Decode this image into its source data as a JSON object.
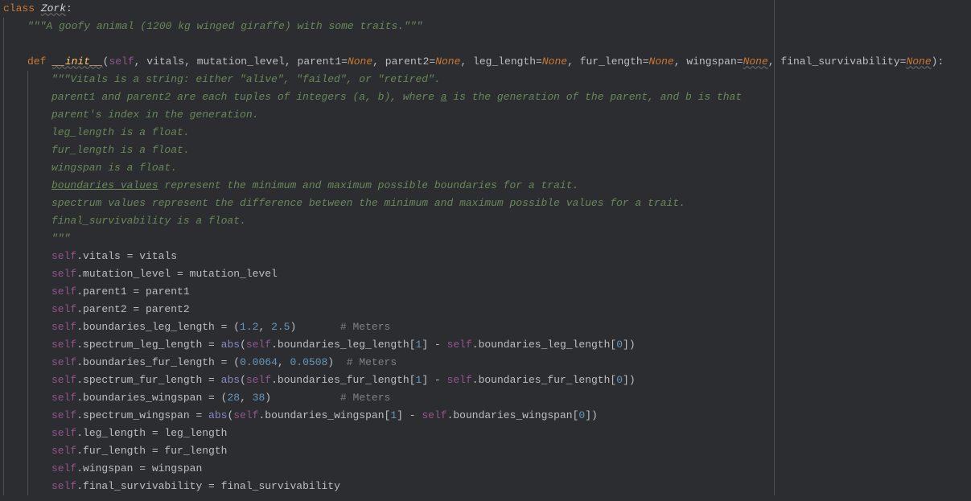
{
  "class_kw": "class",
  "class_name": "Zork",
  "colon": ":",
  "docstring_class": "\"\"\"A goofy animal (1200 kg winged giraffe) with some traits.\"\"\"",
  "def_kw": "def",
  "init_name": "__init__",
  "params": {
    "self": "self",
    "vitals": "vitals",
    "mutation_level": "mutation_level",
    "parent1": "parent1",
    "parent2": "parent2",
    "leg_length": "leg_length",
    "fur_length": "fur_length",
    "wingspan": "wingspan",
    "final_survivability": "final_survivability",
    "none": "None"
  },
  "doc": {
    "l1": "\"\"\"Vitals is a string: either \"alive\", \"failed\", or \"retired\".",
    "l2a": "parent1 and parent2 are each tuples of integers (a, b), where ",
    "l2u": "a",
    "l2b": " is the generation of the parent, and b is that",
    "l3": "parent's index in the generation.",
    "l4": "leg_length is a float.",
    "l5": "fur_length is a float.",
    "l6": "wingspan is a float.",
    "l7u": "boundaries values",
    "l7b": " represent the minimum and maximum possible boundaries for a trait.",
    "l8": "spectrum values represent the difference between the minimum and maximum possible values for a trait.",
    "l9": "final_survivability is a float.",
    "l10": "\"\"\""
  },
  "body": {
    "vitals": ".vitals = vitals",
    "mutation": ".mutation_level = mutation_level",
    "parent1": ".parent1 = parent1",
    "parent2": ".parent2 = parent2",
    "bleg_pre": ".boundaries_leg_length = (",
    "bleg_n1": "1.2",
    "bleg_n2": "2.5",
    "sleg_pre": ".spectrum_leg_length = ",
    "abs": "abs",
    "sleg_mid1": ".boundaries_leg_length[",
    "one": "1",
    "zero": "0",
    "brack_close": "]",
    "minus": " - ",
    "bfur_pre": ".boundaries_fur_length = (",
    "bfur_n1": "0.0064",
    "bfur_n2": "0.0508",
    "sfur_pre": ".spectrum_fur_length = ",
    "sfur_mid1": ".boundaries_fur_length[",
    "bwing_pre": ".boundaries_wingspan = (",
    "bwing_n1": "28",
    "bwing_n2": "38",
    "swing_pre": ".spectrum_wingspan = ",
    "swing_mid1": ".boundaries_wingspan[",
    "leg_assign": ".leg_length = leg_length",
    "fur_assign": ".fur_length = fur_length",
    "wing_assign": ".wingspan = wingspan",
    "final_assign": ".final_survivability = final_survivability",
    "cmt_meters": "# Meters",
    "comma_sp": ", ",
    "paren_close": ")",
    "paren_open": "("
  }
}
